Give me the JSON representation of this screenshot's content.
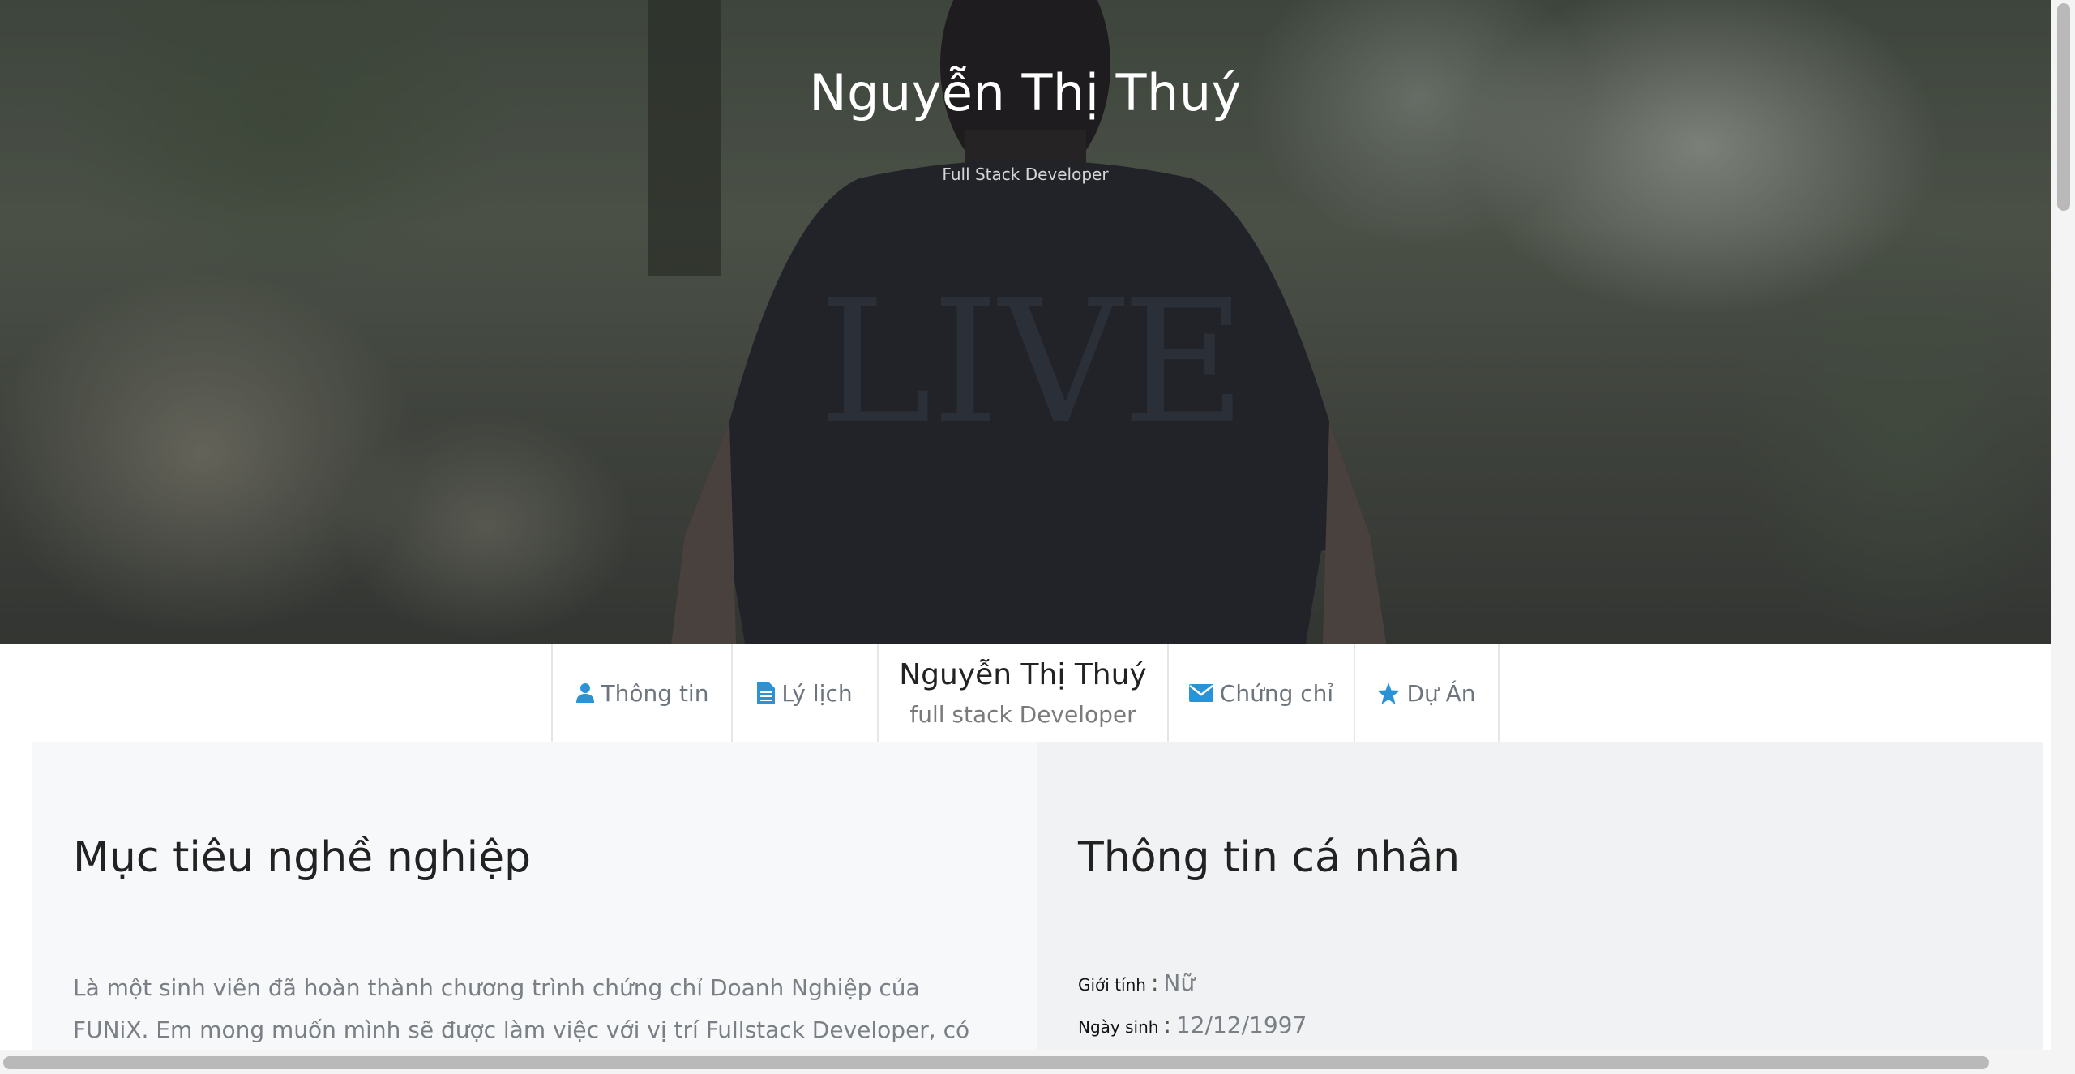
{
  "hero": {
    "name": "Nguyễn Thị Thuý",
    "role": "Full Stack Developer"
  },
  "nav": {
    "items": [
      {
        "label": "Thông tin",
        "icon": "user-icon"
      },
      {
        "label": "Lý lịch",
        "icon": "document-icon"
      },
      {
        "label": "Chứng chỉ",
        "icon": "envelope-icon"
      },
      {
        "label": "Dự Án",
        "icon": "star-icon"
      }
    ],
    "center": {
      "name": "Nguyễn Thị Thuý",
      "role": "full stack Developer"
    },
    "icon_color": "#2a93d5"
  },
  "objective": {
    "title": "Mục tiêu nghề nghiệp",
    "text": "Là một sinh viên đã hoàn thành chương trình chứng chỉ Doanh Nghiệp của FUNiX. Em mong muốn mình sẽ được làm việc với vị trí Fullstack Developer, có thể vận dụng những"
  },
  "personal": {
    "title": "Thông tin cá nhân",
    "rows": [
      {
        "label": "Giới tính",
        "value": "Nữ"
      },
      {
        "label": "Ngày sinh",
        "value": "12/12/1997"
      }
    ]
  }
}
